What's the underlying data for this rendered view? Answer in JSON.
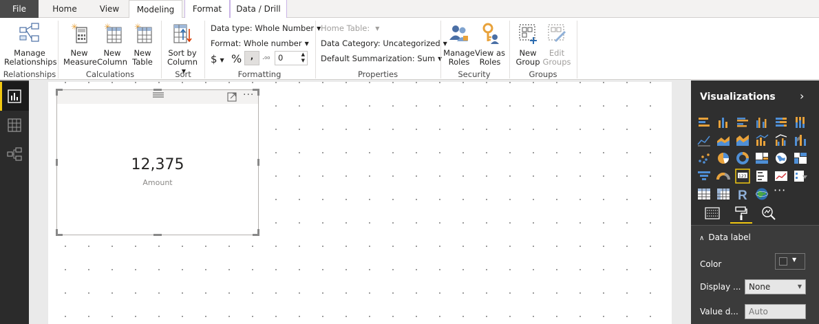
{
  "tabs": {
    "file": "File",
    "home": "Home",
    "view": "View",
    "modeling": "Modeling",
    "format": "Format",
    "data_drill": "Data / Drill"
  },
  "ribbon": {
    "relationships": {
      "manage_line1": "Manage",
      "manage_line2": "Relationships",
      "group": "Relationships"
    },
    "calculations": {
      "new_measure_line1": "New",
      "new_measure_line2": "Measure",
      "new_column_line1": "New",
      "new_column_line2": "Column",
      "new_table_line1": "New",
      "new_table_line2": "Table",
      "group": "Calculations"
    },
    "sort": {
      "sort_line1": "Sort by",
      "sort_line2": "Column",
      "group": "Sort"
    },
    "formatting": {
      "data_type": "Data type: Whole Number",
      "format": "Format: Whole number",
      "currency": "$",
      "percent": "%",
      "comma": ",",
      "decimals": "0",
      "group": "Formatting"
    },
    "properties": {
      "home_table": "Home Table:",
      "data_category": "Data Category: Uncategorized",
      "default_summarization": "Default Summarization: Sum",
      "group": "Properties"
    },
    "security": {
      "manage_roles_line1": "Manage",
      "manage_roles_line2": "Roles",
      "view_as_line1": "View as",
      "view_as_line2": "Roles",
      "group": "Security"
    },
    "groups": {
      "new_group_line1": "New",
      "new_group_line2": "Group",
      "edit_groups_line1": "Edit",
      "edit_groups_line2": "Groups",
      "group": "Groups"
    }
  },
  "card": {
    "value": "12,375",
    "label": "Amount"
  },
  "visualizations": {
    "title": "Visualizations",
    "section_title": "Data label",
    "color_label": "Color",
    "display_label": "Display ...",
    "display_value": "None",
    "value_decimals_label": "Value d...",
    "value_decimals_placeholder": "Auto"
  },
  "colors": {
    "accent": "#f2c811",
    "ribbon_bg": "#ffffff",
    "pane_bg": "#2f2f2f"
  }
}
